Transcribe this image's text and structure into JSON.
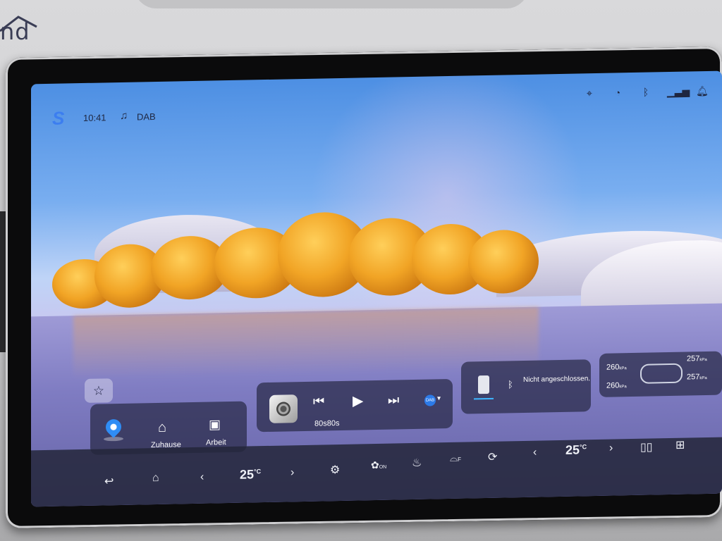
{
  "dash": {
    "brand_fragment": "nd"
  },
  "status": {
    "time": "10:41",
    "source": "DAB",
    "icons": [
      "location-icon",
      "speed-camera-icon",
      "bluetooth-icon",
      "signal-icon",
      "bell-icon"
    ]
  },
  "nav": {
    "home_label": "Zuhause",
    "work_label": "Arbeit"
  },
  "media": {
    "station": "80s80s",
    "badge": "DAB"
  },
  "phone": {
    "status": "Nicht angeschlossen."
  },
  "tires": {
    "fl": "260",
    "fr": "257",
    "rl": "260",
    "rr": "257",
    "unit": "kPa"
  },
  "climate": {
    "driver_temp": "25",
    "passenger_temp": "25",
    "unit": "°C"
  },
  "dock": {
    "fan_label": "ON",
    "defrost_label": "F"
  },
  "colors": {
    "accent": "#2f8df5",
    "dock_bg": "#24263a"
  }
}
